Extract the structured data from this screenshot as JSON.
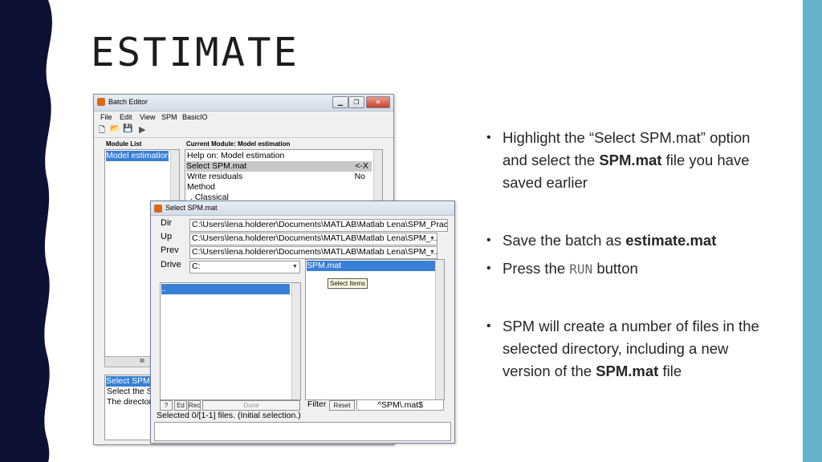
{
  "slide": {
    "title": "ESTIMATE",
    "bullets": [
      {
        "parts": [
          "Highlight the “Select SPM.mat” option and select the ",
          "SPM.mat",
          " file you have saved earlier"
        ]
      },
      {
        "parts": [
          "Save the batch as ",
          "estimate.mat"
        ]
      },
      {
        "parts": [
          "Press the ",
          "RUN",
          " button"
        ]
      },
      {
        "parts": [
          "SPM will create a number of files in the selected directory, including a new version of the ",
          "SPM.mat",
          " file"
        ]
      }
    ],
    "colors": {
      "wave": "#0e1133",
      "right_bar": "#64b3c9"
    }
  },
  "batch_editor": {
    "title": "Batch Editor",
    "window_buttons": [
      "▁",
      "❐",
      "✕"
    ],
    "menu": [
      "File",
      "Edit",
      "View",
      "SPM",
      "BasicIO"
    ],
    "toolbar": {
      "new": "🗋",
      "open": "📂",
      "save": "💾",
      "run": "▶"
    },
    "module_list_label": "Module List",
    "current_module_label": "Current Module: Model estimation",
    "module_list": [
      "Model estimation"
    ],
    "module_items": [
      {
        "label": "Help on: Model estimation",
        "value": ""
      },
      {
        "label": "Select SPM.mat",
        "value": "<-X"
      },
      {
        "label": "Write residuals",
        "value": "No"
      },
      {
        "label": "Method",
        "value": ""
      },
      {
        "label": ". Classical",
        "value": ""
      }
    ],
    "info_lines": [
      "Select SPM",
      "Select the S",
      "The director"
    ],
    "hscroll_text": "III"
  },
  "select_dialog": {
    "title": "Select SPM.mat",
    "window_buttons": [
      "▁",
      "❐",
      "✕"
    ],
    "dir_label": "Dir",
    "dir_value": "C:\\Users\\lena.holderer\\Documents\\MATLAB\\Matlab Lena\\SPM_Prac",
    "up_label": "Up",
    "up_value": "C:\\Users\\lena.holderer\\Documents\\MATLAB\\Matlab Lena\\SPM_...",
    "prev_label": "Prev",
    "prev_value": "C:\\Users\\lena.holderer\\Documents\\MATLAB\\Matlab Lena\\SPM_...",
    "drive_label": "Drive",
    "drive_value": "C:",
    "dir_list": [
      ".."
    ],
    "file_list": [
      "SPM.mat"
    ],
    "tooltip": "Select Items",
    "buttons": {
      "help": "?",
      "ed": "Ed",
      "rec": "Rec",
      "done": "Done"
    },
    "filter_label": "Filter",
    "reset_label": "Reset",
    "filter_value": "^SPM\\.mat$",
    "status": "Selected 0/[1-1] files. (Initial selection.)"
  }
}
